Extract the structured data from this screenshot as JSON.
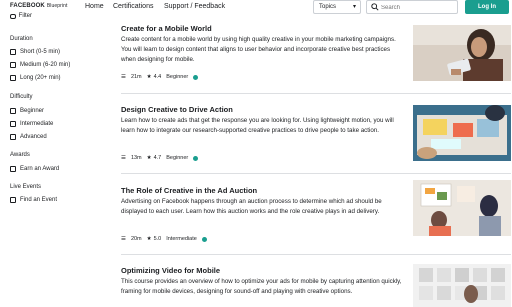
{
  "header": {
    "logo": "FACEBOOK",
    "logo_sub": "Blueprint",
    "nav": [
      "Home",
      "Certifications",
      "Support / Feedback"
    ],
    "topics_label": "Topics",
    "search_placeholder": "Search",
    "login_label": "Log In",
    "accent": "#1a9e8f"
  },
  "sidebar": {
    "filter_label": "Filter",
    "sections": [
      {
        "title": "Duration",
        "options": [
          "Short (0-5 min)",
          "Medium (6-20 min)",
          "Long (20+ min)"
        ]
      },
      {
        "title": "Difficulty",
        "options": [
          "Beginner",
          "Intermediate",
          "Advanced"
        ]
      },
      {
        "title": "Awards",
        "options": [
          "Earn an Award"
        ]
      },
      {
        "title": "Live Events",
        "options": [
          "Find an Event"
        ]
      }
    ]
  },
  "courses": [
    {
      "title": "Create for a Mobile World",
      "description": "Create content for a mobile world by using high quality creative in your mobile marketing campaigns. You will learn to design content that aligns to user behavior and incorporate creative best practices when designing for mobile.",
      "duration": "21m",
      "rating": "4.4",
      "level": "Beginner"
    },
    {
      "title": "Design Creative to Drive Action",
      "description": "Learn how to create ads that get the response you are looking for. Using lightweight motion, you will learn how to integrate our research-supported creative practices to drive people to take action.",
      "duration": "13m",
      "rating": "4.7",
      "level": "Beginner"
    },
    {
      "title": "The Role of Creative in the Ad Auction",
      "description": "Advertising on Facebook happens through an auction process to determine which ad should be displayed to each user. Learn how this auction works and the role creative plays in ad delivery.",
      "duration": "20m",
      "rating": "5.0",
      "level": "Intermediate"
    },
    {
      "title": "Optimizing Video for Mobile",
      "description": "This course provides an overview of how to optimize your ads for mobile by capturing attention quickly, framing for mobile devices, designing for sound-off and playing with creative options.",
      "duration": "",
      "rating": "",
      "level": ""
    }
  ]
}
